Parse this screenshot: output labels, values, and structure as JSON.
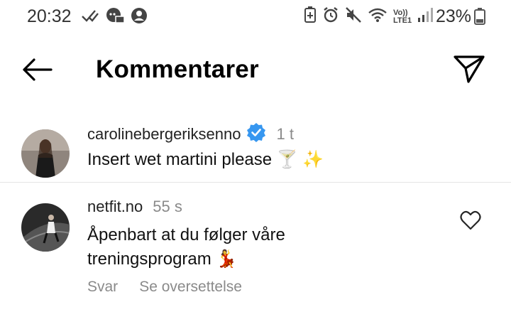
{
  "status_bar": {
    "time": "20:32",
    "battery_percent": "23%",
    "network_label": "Vo)) LTE1"
  },
  "header": {
    "title": "Kommentarer"
  },
  "comments": [
    {
      "username": "carolinebergeriksenno",
      "verified": true,
      "time": "1 t",
      "text": "Insert wet martini please 🍸 ✨"
    },
    {
      "username": "netfit.no",
      "time": "55 s",
      "text": "Åpenbart at du følger våre treningsprogram 💃",
      "reply_label": "Svar",
      "translate_label": "Se oversettelse",
      "liked": false
    }
  ],
  "colors": {
    "verified": "#3797f0",
    "secondary_text": "#8a8a8a",
    "divider": "#e4e4e4"
  }
}
